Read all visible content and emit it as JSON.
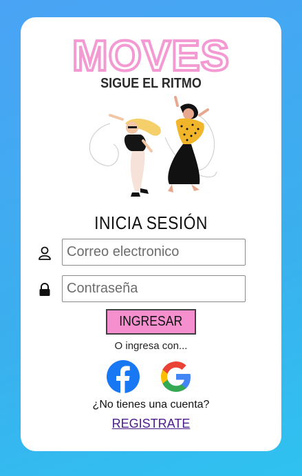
{
  "brand": {
    "name": "MOVES",
    "tagline": "SIGUE EL RITMO",
    "accent": "#f39ad3"
  },
  "login": {
    "title": "INICIA SESIÓN",
    "email": {
      "placeholder": "Correo electronico",
      "value": "",
      "icon": "user-icon"
    },
    "password": {
      "placeholder": "Contraseña",
      "value": "",
      "icon": "lock-icon"
    },
    "submit_label": "INGRESAR",
    "submit_color": "#f58fce"
  },
  "alt_login": {
    "label": "O ingresa con...",
    "providers": [
      {
        "name": "facebook",
        "icon": "facebook-icon",
        "color": "#1877f2"
      },
      {
        "name": "google",
        "icon": "google-icon"
      }
    ]
  },
  "signup": {
    "prompt": "¿No tienes una cuenta?",
    "link_label": "REGISTRATE"
  },
  "colors": {
    "background": "#3ab0ee",
    "card": "#ffffff",
    "link": "#4a1a8a"
  }
}
